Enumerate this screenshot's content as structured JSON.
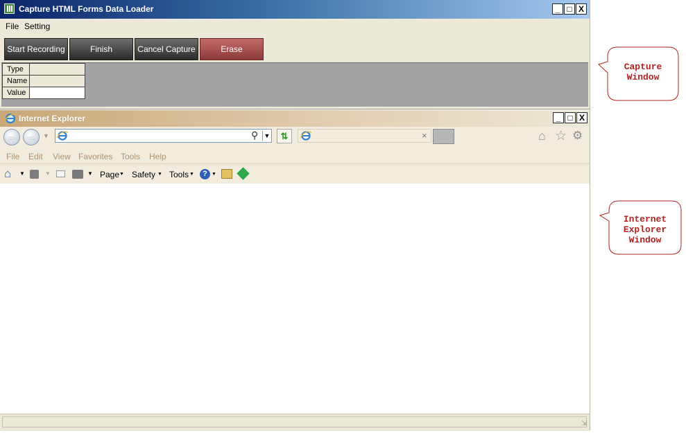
{
  "capture_window": {
    "title": "Capture HTML Forms Data Loader",
    "controls": {
      "minimize": "_",
      "maximize": "□",
      "close": "X"
    },
    "menu": [
      "File",
      "Setting"
    ],
    "toolbar": {
      "start_recording": "Start Recording",
      "finish": "Finish",
      "cancel_capture": "Cancel Capture",
      "erase": "Erase"
    },
    "fields": [
      {
        "label": "Type",
        "value": ""
      },
      {
        "label": "Name",
        "value": ""
      },
      {
        "label": "Value",
        "value": ""
      }
    ]
  },
  "ie_window": {
    "title": "Internet Explorer",
    "controls": {
      "minimize": "_",
      "maximize": "□",
      "close": "X"
    },
    "address": {
      "value": "",
      "placeholder": ""
    },
    "menu": [
      "File",
      "Edit",
      "View",
      "Favorites",
      "Tools",
      "Help"
    ],
    "commandbar": {
      "page": "Page",
      "safety": "Safety",
      "tools": "Tools"
    },
    "icons": [
      "home-icon",
      "favorites-star-icon",
      "gear-icon",
      "rss-feed-icon",
      "mail-icon",
      "print-icon",
      "help-icon",
      "research-icon"
    ]
  },
  "callouts": {
    "capture": [
      "Capture",
      "Window"
    ],
    "ie": [
      "Internet",
      "Explorer",
      "Window"
    ]
  },
  "colors": {
    "capture_title_start": "#0a246a",
    "capture_title_end": "#a6caf0",
    "ie_title_start": "#c9a777",
    "erase_button": "#a84d4d",
    "callout_text": "#b22222"
  }
}
